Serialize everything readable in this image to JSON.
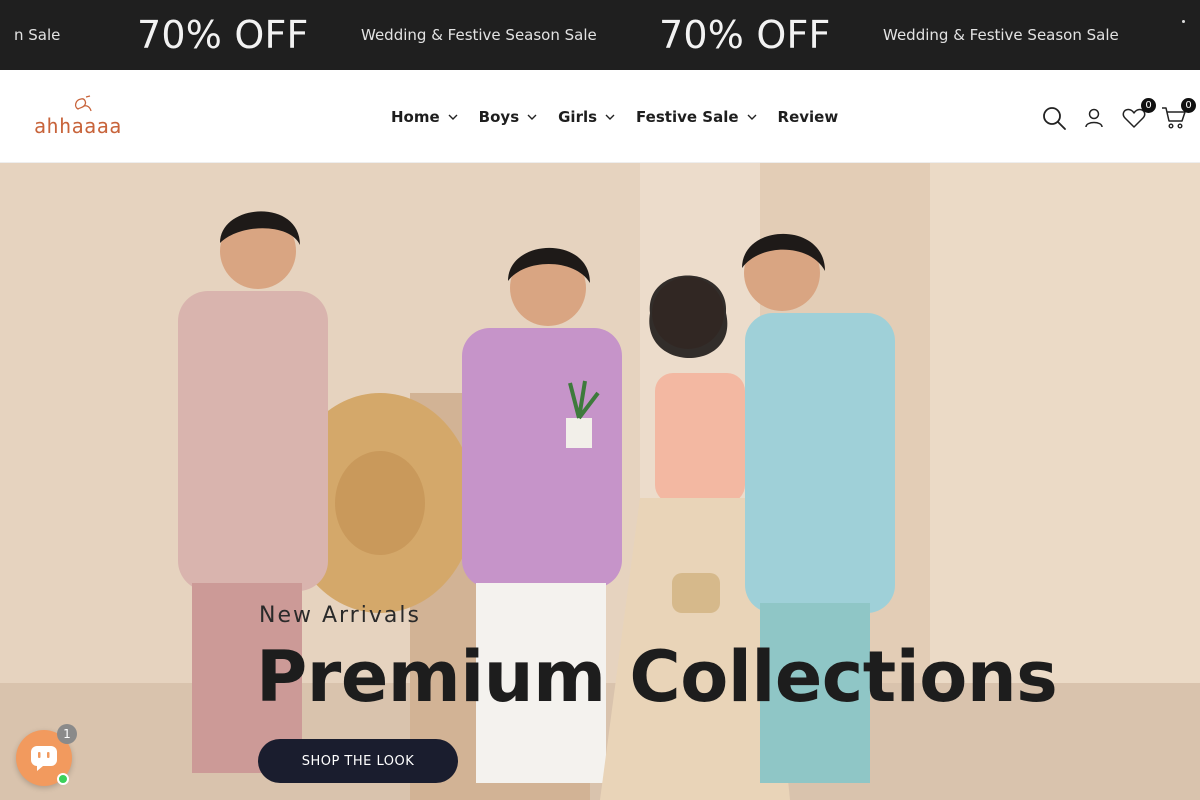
{
  "announcement": {
    "items": [
      "n Sale",
      "70% OFF",
      "Wedding & Festive Season Sale",
      "70% OFF",
      "Wedding & Festive Season Sale"
    ]
  },
  "header": {
    "logo_text": "ahhaaaa",
    "nav": [
      {
        "label": "Home",
        "has_dropdown": true
      },
      {
        "label": "Boys",
        "has_dropdown": true
      },
      {
        "label": "Girls",
        "has_dropdown": true
      },
      {
        "label": "Festive Sale",
        "has_dropdown": true
      },
      {
        "label": "Review",
        "has_dropdown": false
      }
    ],
    "icons": {
      "search": "search-icon",
      "account": "user-icon",
      "wishlist": "heart-icon",
      "cart": "cart-icon"
    },
    "wishlist_count": "0",
    "cart_count": "0"
  },
  "hero": {
    "kicker": "New Arrivals",
    "headline": "Premium Collections",
    "cta_label": "SHOP THE LOOK"
  },
  "chat": {
    "unread": "1"
  },
  "colors": {
    "announcement_bg": "#1f1f1f",
    "logo": "#c8643b",
    "cta_bg": "#1a1d2e",
    "chat_bg": "#f29a5e",
    "online": "#3bd15a"
  }
}
